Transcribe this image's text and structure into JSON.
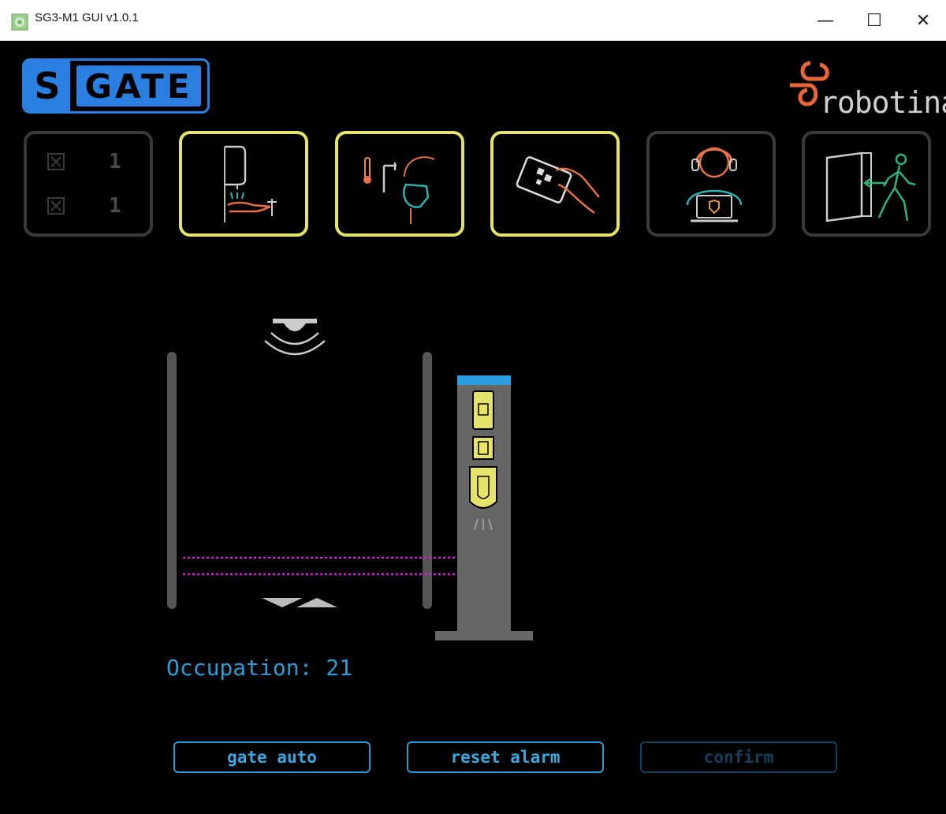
{
  "window": {
    "title": "SG3-M1 GUI v1.0.1",
    "controls": {
      "minimize": "—",
      "maximize": "☐",
      "close": "✕"
    }
  },
  "logo": {
    "left_glyph": "S",
    "right_text": "GATE"
  },
  "brand": {
    "text": "robotina"
  },
  "status_tiles": [
    {
      "icon": "counter-icon",
      "active": false,
      "counter_top": "1",
      "counter_bottom": "1"
    },
    {
      "icon": "hand-sanitizer-icon",
      "active": true
    },
    {
      "icon": "temperature-mask-check-icon",
      "active": true
    },
    {
      "icon": "qr-card-scan-icon",
      "active": true
    },
    {
      "icon": "operator-support-icon",
      "active": false
    },
    {
      "icon": "exit-door-walker-icon",
      "active": false
    }
  ],
  "occupation": {
    "label": "Occupation: 21",
    "value": 21
  },
  "buttons": {
    "gate_auto": "gate auto",
    "reset_alarm": "reset alarm",
    "confirm": "confirm"
  },
  "colors": {
    "accent_blue": "#2d9bd3",
    "tile_active": "#e6e36a",
    "tile_inactive": "#3a3a3a",
    "laser": "#d51ed6",
    "logo_blue": "#2a7fe0",
    "brand_orange": "#e8663a"
  }
}
